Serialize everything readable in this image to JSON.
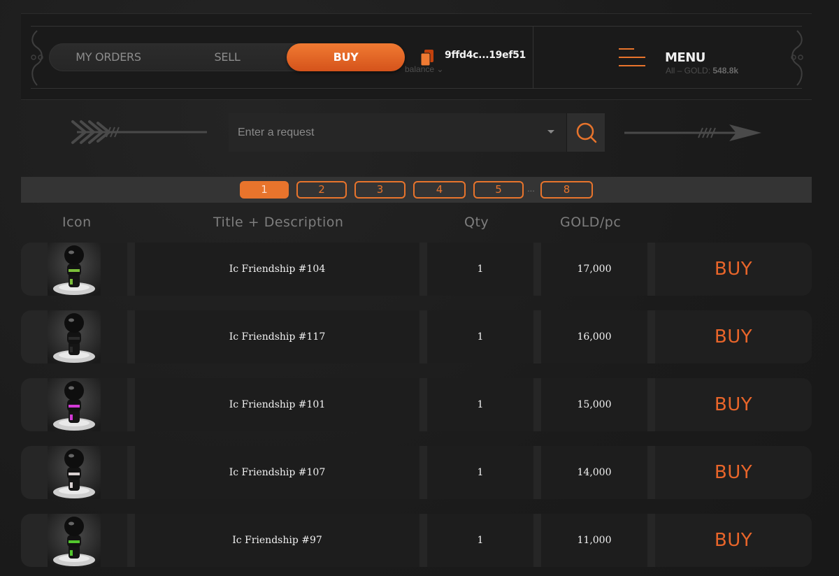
{
  "header": {
    "tabs": {
      "my_orders": "MY ORDERS",
      "sell": "SELL",
      "buy": "BUY"
    },
    "wallet": {
      "address": "9ffd4c...19ef51",
      "balance_label": "balance"
    },
    "ghost_text": {
      "prefix": "All – GOLD",
      "value": "548.8k"
    },
    "menu_label": "MENU"
  },
  "search": {
    "placeholder": "Enter a request"
  },
  "pagination": {
    "pages": [
      "1",
      "2",
      "3",
      "4",
      "5",
      "8"
    ],
    "active": "1",
    "ellipsis": "..."
  },
  "columns": {
    "icon": "Icon",
    "title": "Title + Description",
    "qty": "Qty",
    "price": "GOLD/pc"
  },
  "rows": [
    {
      "title": "Ic Friendship #104",
      "qty": "1",
      "price": "17,000",
      "action": "BUY",
      "accent": "#7bbf3a"
    },
    {
      "title": "Ic Friendship #117",
      "qty": "1",
      "price": "16,000",
      "action": "BUY",
      "accent": "#2a2a2a"
    },
    {
      "title": "Ic Friendship #101",
      "qty": "1",
      "price": "15,000",
      "action": "BUY",
      "accent": "#d23ad6"
    },
    {
      "title": "Ic Friendship #107",
      "qty": "1",
      "price": "14,000",
      "action": "BUY",
      "accent": "#d8d0d0"
    },
    {
      "title": "Ic Friendship #97",
      "qty": "1",
      "price": "11,000",
      "action": "BUY",
      "accent": "#53c72e"
    }
  ],
  "colors": {
    "accent": "#e8742c",
    "background": "#1e1e1e"
  }
}
